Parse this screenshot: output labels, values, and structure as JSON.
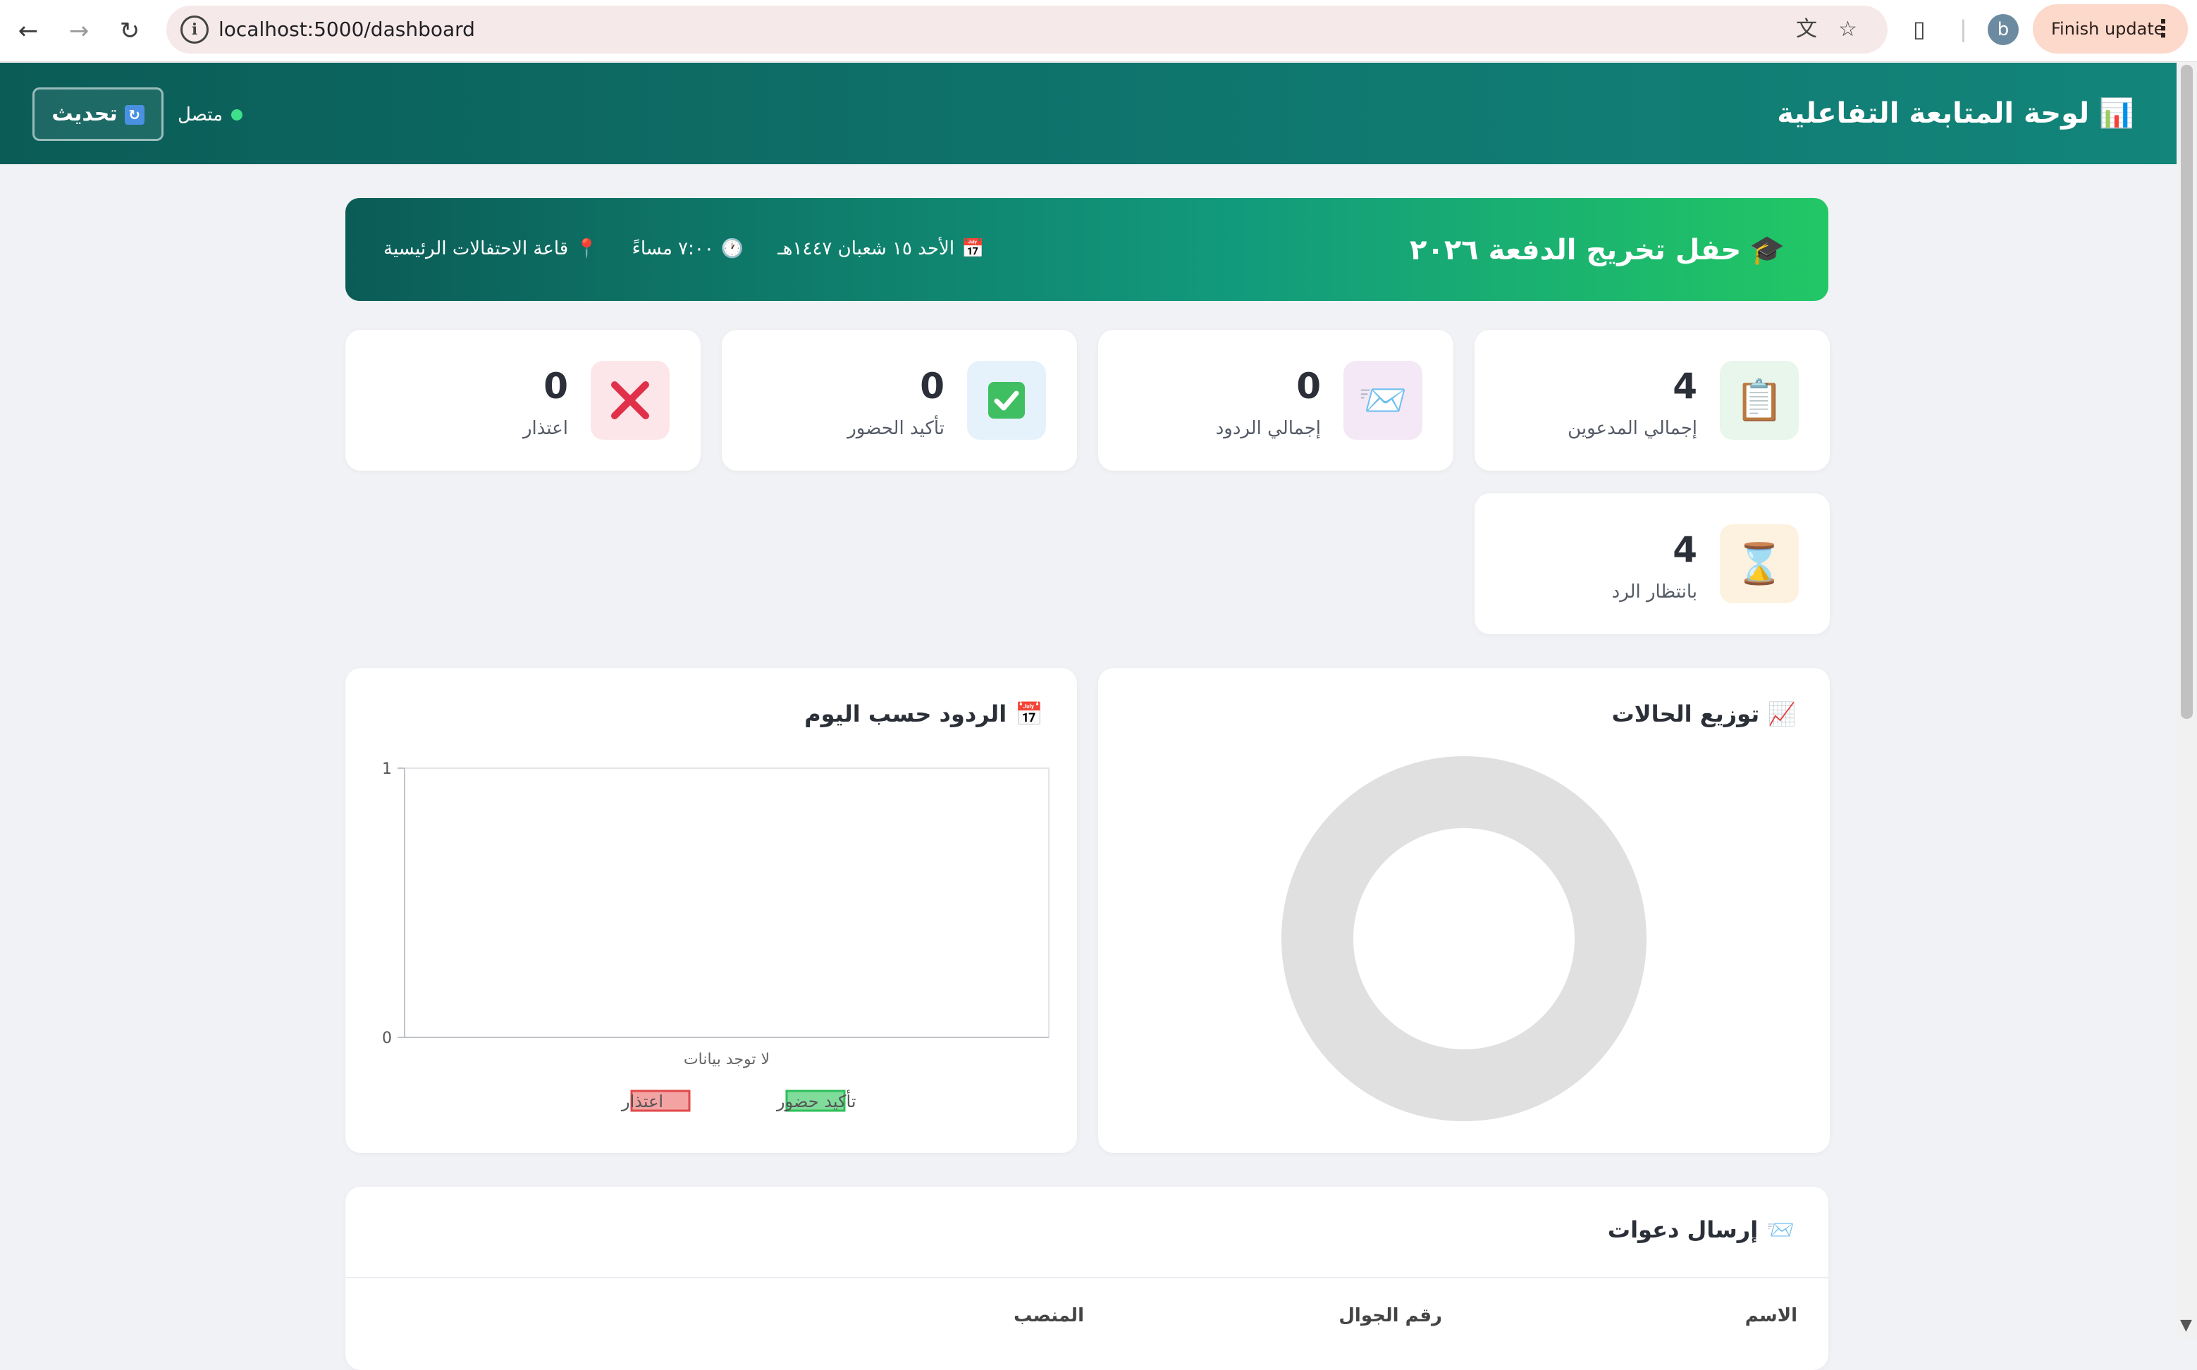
{
  "browser": {
    "url": "localhost:5000/dashboard",
    "profile_initial": "b",
    "update_label": "Finish update"
  },
  "header": {
    "icon": "bar-chart-icon",
    "title": "لوحة المتابعة التفاعلية",
    "refresh_label": "تحديث",
    "status_label": "متصل",
    "status_color": "#3ee08a"
  },
  "event": {
    "icon": "graduation-cap-icon",
    "title": "حفل تخريج الدفعة ٢٠٢٦",
    "date": "الأحد ١٥ شعبان ١٤٤٧هـ",
    "time": "٧:٠٠ مساءً",
    "location": "قاعة الاحتفالات الرئيسية"
  },
  "stats": [
    {
      "value": "4",
      "label": "إجمالي المدعوين",
      "icon": "clipboard-icon",
      "bg": "#e8f6ec"
    },
    {
      "value": "0",
      "label": "إجمالي الردود",
      "icon": "envelope-icon",
      "bg": "#f5e8f6"
    },
    {
      "value": "0",
      "label": "تأكيد الحضور",
      "icon": "check-icon",
      "bg": "#e6f2fb"
    },
    {
      "value": "0",
      "label": "اعتذار",
      "icon": "cross-icon",
      "bg": "#fde6ea"
    },
    {
      "value": "4",
      "label": "بانتظار الرد",
      "icon": "hourglass-icon",
      "bg": "#fdf1e0"
    }
  ],
  "status_chart": {
    "title": "توزيع الحالات",
    "icon": "line-chart-icon"
  },
  "daily_chart": {
    "title": "الردود حسب اليوم",
    "icon": "calendar-icon"
  },
  "chart_data": [
    {
      "type": "pie",
      "title": "توزيع الحالات",
      "categories": [],
      "values": [],
      "empty_color": "#e0e0e0"
    },
    {
      "type": "bar",
      "title": "الردود حسب اليوم",
      "categories": [],
      "x_placeholder": "لا توجد بيانات",
      "series": [
        {
          "name": "تأكيد حضور",
          "values": [],
          "color": "#7fdc9a",
          "border": "#2ebf5a"
        },
        {
          "name": "اعتذار",
          "values": [],
          "color": "#f4a3a3",
          "border": "#e0494a"
        }
      ],
      "ylim": [
        0,
        1
      ],
      "yticks": [
        "0",
        "1"
      ]
    }
  ],
  "invite": {
    "title": "إرسال دعوات",
    "icon": "envelope-icon",
    "columns": [
      "الاسم",
      "رقم الجوال",
      "المنصب"
    ]
  }
}
